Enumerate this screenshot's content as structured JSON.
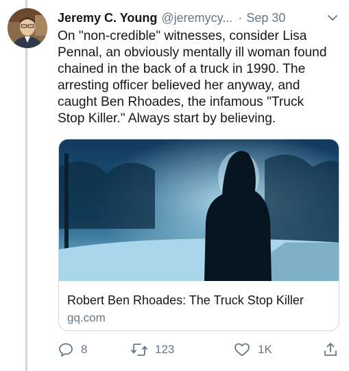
{
  "author": {
    "name": "Jeremy C. Young",
    "handle": "@jeremycy...",
    "separator": "·",
    "date": "Sep 30"
  },
  "tweet": {
    "lines": [
      "On \"non-credible\" witnesses, consider Lisa",
      "Pennal, an obviously mentally ill woman found",
      "chained in the back of a truck in 1990. The",
      "arresting officer believed her anyway, and",
      "caught Ben Rhoades, the infamous \"Truck",
      "Stop Killer.\" Always start by believing."
    ]
  },
  "link_card": {
    "title": "Robert Ben Rhoades: The Truck Stop Killer",
    "domain": "gq.com"
  },
  "actions": {
    "reply_count": "8",
    "retweet_count": "123",
    "like_count": "1K"
  },
  "icons": {
    "caret": "chevron-down-icon",
    "reply": "reply-icon",
    "retweet": "retweet-icon",
    "like": "heart-icon",
    "share": "share-icon"
  },
  "colors": {
    "text": "#14171a",
    "secondary": "#657786",
    "border": "#ccd6dd"
  }
}
